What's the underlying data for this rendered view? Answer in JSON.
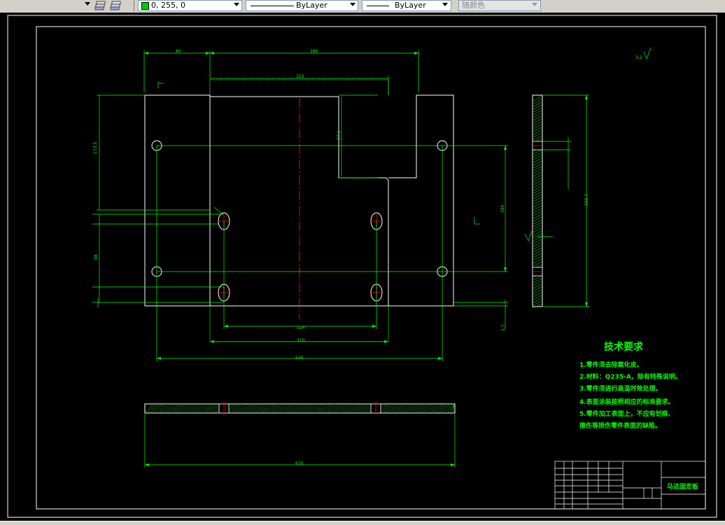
{
  "toolbar": {
    "color_value": "0, 255, 0",
    "color_swatch": "#00cc00",
    "linetype_label": "ByLayer",
    "lineweight_label": "ByLayer",
    "plotstyle_label": "随颜色"
  },
  "drawing": {
    "surface_finish": "3.2",
    "tech_title": "技术要求",
    "tech_notes": [
      "1.零件须去除氧化皮。",
      "2.材料：Q235-A，除有特殊说明。",
      "3.零件须进行高温时效处理。",
      "4.表面涂装按照相应的标准要求。",
      "5.零件加工表面上，不应有划痕、",
      "擦伤等损伤零件表面的缺陷。"
    ],
    "title_block": {
      "part_name": "马达固定板"
    },
    "dims": {
      "hole_spacing": "124",
      "slot_span": "310",
      "hole_span": "540",
      "bottom_width": "670",
      "side_total": "350.7",
      "side_offset": "5.7",
      "cutout_depth": "87.1",
      "left_upper": "173.5",
      "top_left": "80",
      "top_span": "386",
      "top_inner": "310",
      "right_height": "180",
      "left_lower": "98"
    }
  },
  "colors": {
    "part": "#ffffff",
    "dim": "#00ff00",
    "center": "#ff0000",
    "notes": "#00ff00",
    "frame": "#ffffff",
    "hatch": "#00ff00",
    "hole": "#ffff00"
  }
}
